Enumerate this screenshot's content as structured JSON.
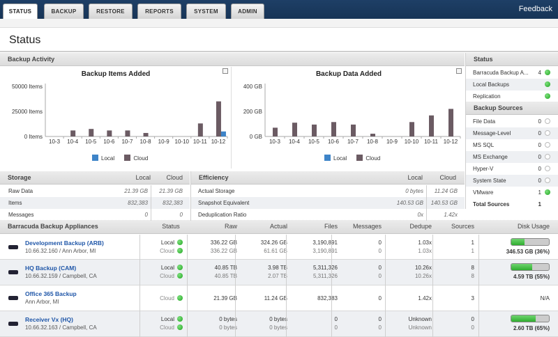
{
  "nav": {
    "tabs": [
      "STATUS",
      "BACKUP",
      "RESTORE",
      "REPORTS",
      "SYSTEM",
      "ADMIN"
    ],
    "active": "STATUS",
    "feedback": "Feedback"
  },
  "page_title": "Status",
  "backup_activity": {
    "header": "Backup Activity",
    "legend_local": "Local",
    "legend_cloud": "Cloud",
    "colors": {
      "local": "#3e84c8",
      "cloud": "#6b5b63"
    }
  },
  "chart_data": [
    {
      "type": "bar",
      "title": "Backup Items Added",
      "categories": [
        "10-3",
        "10-4",
        "10-5",
        "10-6",
        "10-7",
        "10-8",
        "10-9",
        "10-10",
        "10-11",
        "10-12"
      ],
      "series": [
        {
          "name": "Cloud",
          "values": [
            0,
            6000,
            7500,
            6000,
            6000,
            3500,
            0,
            0,
            13000,
            35000
          ]
        },
        {
          "name": "Local",
          "values": [
            0,
            0,
            0,
            0,
            0,
            0,
            0,
            0,
            0,
            5000
          ]
        }
      ],
      "yticks": [
        "0 Items",
        "25000 Items",
        "50000 Items"
      ],
      "ylim": [
        0,
        50000
      ]
    },
    {
      "type": "bar",
      "title": "Backup Data Added",
      "categories": [
        "10-3",
        "10-4",
        "10-5",
        "10-6",
        "10-7",
        "10-8",
        "10-9",
        "10-10",
        "10-11",
        "10-12"
      ],
      "series": [
        {
          "name": "Cloud",
          "values": [
            70,
            110,
            95,
            115,
            95,
            22,
            0,
            115,
            168,
            220
          ]
        },
        {
          "name": "Local",
          "values": [
            0,
            0,
            0,
            0,
            0,
            0,
            0,
            0,
            0,
            0
          ]
        }
      ],
      "yticks": [
        "0 GB",
        "200 GB",
        "400 GB"
      ],
      "ylim": [
        0,
        400
      ]
    }
  ],
  "storage": {
    "header": "Storage",
    "col_local": "Local",
    "col_cloud": "Cloud",
    "rows": [
      {
        "label": "Raw Data",
        "local": "21.39 GB",
        "cloud": "21.39 GB"
      },
      {
        "label": "Items",
        "local": "832,383",
        "cloud": "832,383"
      },
      {
        "label": "Messages",
        "local": "0",
        "cloud": "0"
      }
    ]
  },
  "efficiency": {
    "header": "Efficiency",
    "col_local": "Local",
    "col_cloud": "Cloud",
    "rows": [
      {
        "label": "Actual Storage",
        "local": "0 bytes",
        "cloud": "11.24 GB"
      },
      {
        "label": "Snapshot Equivalent",
        "local": "140.53 GB",
        "cloud": "140.53 GB"
      },
      {
        "label": "Deduplication Ratio",
        "local": "0x",
        "cloud": "1.42x"
      }
    ]
  },
  "status_panel": {
    "header": "Status",
    "rows": [
      {
        "label": "Barracuda Backup A...",
        "count": "4",
        "ok": true
      },
      {
        "label": "Local Backups",
        "count": "",
        "ok": true
      },
      {
        "label": "Replication",
        "count": "",
        "ok": true
      }
    ]
  },
  "backup_sources": {
    "header": "Backup Sources",
    "rows": [
      {
        "label": "File Data",
        "count": "0",
        "ok": false
      },
      {
        "label": "Message-Level",
        "count": "0",
        "ok": false
      },
      {
        "label": "MS SQL",
        "count": "0",
        "ok": false
      },
      {
        "label": "MS Exchange",
        "count": "0",
        "ok": false
      },
      {
        "label": "Hyper-V",
        "count": "0",
        "ok": false
      },
      {
        "label": "System State",
        "count": "0",
        "ok": false
      },
      {
        "label": "VMware",
        "count": "1",
        "ok": true
      }
    ],
    "total_label": "Total Sources",
    "total": "1"
  },
  "appliances": {
    "header": "Barracuda Backup Appliances",
    "columns": [
      "Status",
      "Raw",
      "Actual",
      "Files",
      "Messages",
      "Dedupe",
      "Sources",
      "Disk Usage"
    ],
    "rows": [
      {
        "name": "Development Backup (ARB)",
        "sub": "10.66.32.160 / Ann Arbor, MI",
        "lines": [
          {
            "status": "Local",
            "raw": "336.22 GB",
            "actual": "324.26 GB",
            "files": "3,190,891",
            "messages": "0",
            "dedupe": "1.03x",
            "sources": "1"
          },
          {
            "status": "Cloud",
            "raw": "336.22 GB",
            "actual": "61.61 GB",
            "files": "3,190,891",
            "messages": "0",
            "dedupe": "1.03x",
            "sources": "1"
          }
        ],
        "disk_text": "346.53 GB (36%)",
        "disk_fraction": 0.36
      },
      {
        "name": "HQ Backup (CAM)",
        "sub": "10.66.32.159 / Campbell, CA",
        "lines": [
          {
            "status": "Local",
            "raw": "40.85 TB",
            "actual": "3.98 TB",
            "files": "5,311,326",
            "messages": "0",
            "dedupe": "10.26x",
            "sources": "8"
          },
          {
            "status": "Cloud",
            "raw": "40.85 TB",
            "actual": "2.07 TB",
            "files": "5,311,326",
            "messages": "0",
            "dedupe": "10.26x",
            "sources": "8"
          }
        ],
        "disk_text": "4.59 TB (55%)",
        "disk_fraction": 0.55
      },
      {
        "name": "Office 365 Backup",
        "sub": "Ann Arbor, MI",
        "lines": [
          {
            "status": "Cloud",
            "raw": "21.39 GB",
            "actual": "11.24 GB",
            "files": "832,383",
            "messages": "0",
            "dedupe": "1.42x",
            "sources": "3"
          }
        ],
        "disk_text": "N/A",
        "disk_fraction": null
      },
      {
        "name": "Receiver Vx (HQ)",
        "sub": "10.66.32.163 / Campbell, CA",
        "lines": [
          {
            "status": "Local",
            "raw": "0 bytes",
            "actual": "0 bytes",
            "files": "0",
            "messages": "0",
            "dedupe": "Unknown",
            "sources": "0"
          },
          {
            "status": "Cloud",
            "raw": "0 bytes",
            "actual": "0 bytes",
            "files": "0",
            "messages": "0",
            "dedupe": "Unknown",
            "sources": "0"
          }
        ],
        "disk_text": "2.60 TB (65%)",
        "disk_fraction": 0.65
      }
    ]
  }
}
